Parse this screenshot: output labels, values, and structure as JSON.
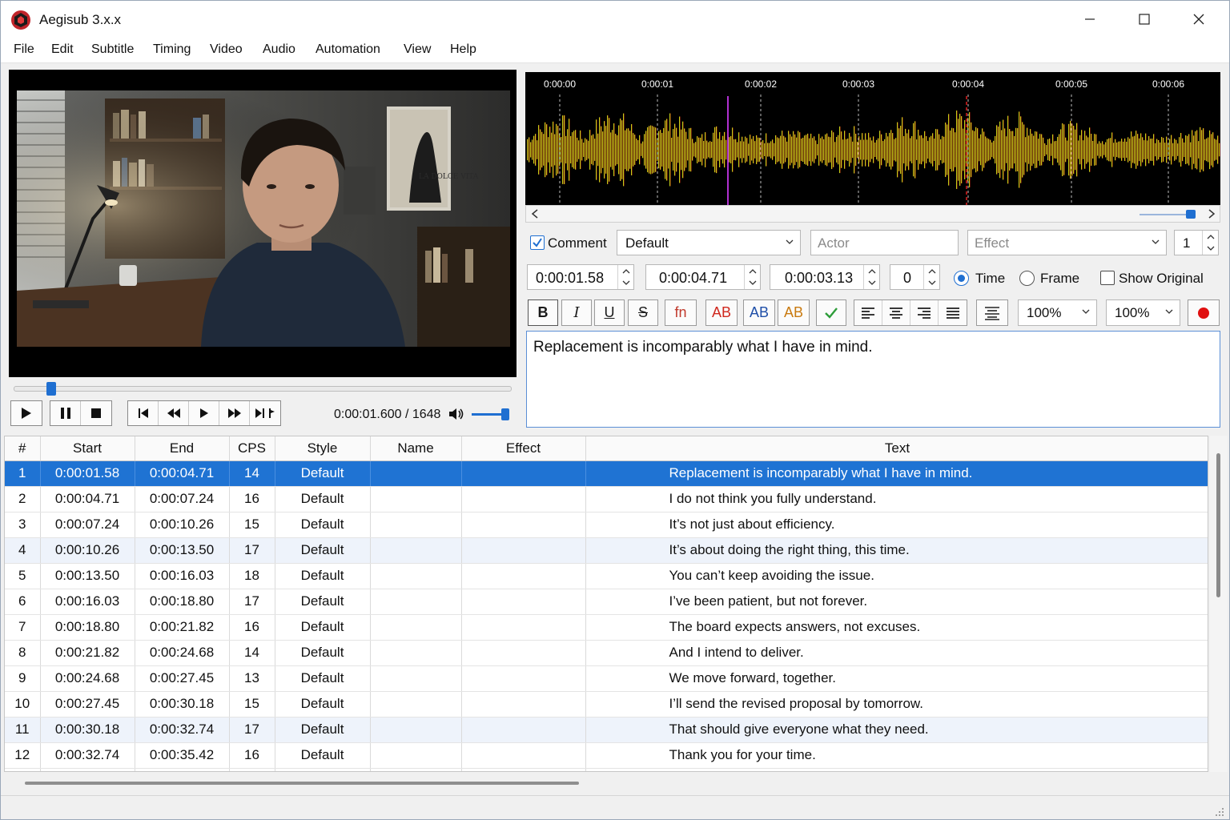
{
  "window": {
    "title": "Aegisub 3.x.x"
  },
  "menu": [
    "File",
    "Edit",
    "Subtitle",
    "Timing",
    "Video",
    "Audio",
    "Automation",
    "View",
    "Help"
  ],
  "video": {
    "time_readout": "0:00:01.600 / 1648",
    "poster_text": "LA DOLCE VITA"
  },
  "audio": {
    "time_marks": [
      "0:00:00",
      "0:00:01",
      "0:00:02",
      "0:00:03",
      "0:00:04",
      "0:00:05",
      "0:00:06"
    ]
  },
  "edit": {
    "comment_label": "Comment",
    "comment_checked": true,
    "style_value": "Default",
    "actor_placeholder": "Actor",
    "effect_placeholder": "Effect",
    "layer": "1",
    "start_time": "0:00:01.58",
    "end_time": "0:00:04.71",
    "duration": "0:00:03.13",
    "margin": "0",
    "mode_time_label": "Time",
    "mode_frame_label": "Frame",
    "mode_selected": "Time",
    "show_original_label": "Show Original",
    "format_buttons": {
      "bold": "B",
      "italic": "I",
      "underline": "U",
      "strike": "S",
      "font": "fn",
      "color1": "AB",
      "color2": "AB",
      "color3": "AB"
    },
    "scale_x": "100%",
    "scale_y": "100%",
    "text": "Replacement is incomparably what I have in mind."
  },
  "grid": {
    "columns": [
      "#",
      "Start",
      "End",
      "CPS",
      "Style",
      "Name",
      "Effect",
      "Text"
    ],
    "selected_row": 1,
    "rows": [
      [
        "1",
        "0:00:01.58",
        "0:00:04.71",
        "14",
        "Default",
        "",
        "",
        "Replacement is incomparably what I have in mind."
      ],
      [
        "2",
        "0:00:04.71",
        "0:00:07.24",
        "16",
        "Default",
        "",
        "",
        "I do not think you fully understand."
      ],
      [
        "3",
        "0:00:07.24",
        "0:00:10.26",
        "15",
        "Default",
        "",
        "",
        "It’s not just about efficiency."
      ],
      [
        "4",
        "0:00:10.26",
        "0:00:13.50",
        "17",
        "Default",
        "",
        "",
        "It’s about doing the right thing, this time."
      ],
      [
        "5",
        "0:00:13.50",
        "0:00:16.03",
        "18",
        "Default",
        "",
        "",
        "You can’t keep avoiding the issue."
      ],
      [
        "6",
        "0:00:16.03",
        "0:00:18.80",
        "17",
        "Default",
        "",
        "",
        "I’ve been patient, but not forever."
      ],
      [
        "7",
        "0:00:18.80",
        "0:00:21.82",
        "16",
        "Default",
        "",
        "",
        "The board expects answers, not excuses."
      ],
      [
        "8",
        "0:00:21.82",
        "0:00:24.68",
        "14",
        "Default",
        "",
        "",
        "And I intend to deliver."
      ],
      [
        "9",
        "0:00:24.68",
        "0:00:27.45",
        "13",
        "Default",
        "",
        "",
        "We move forward, together."
      ],
      [
        "10",
        "0:00:27.45",
        "0:00:30.18",
        "15",
        "Default",
        "",
        "",
        "I’ll send the revised proposal by tomorrow."
      ],
      [
        "11",
        "0:00:30.18",
        "0:00:32.74",
        "17",
        "Default",
        "",
        "",
        "That should give everyone what they need."
      ],
      [
        "12",
        "0:00:32.74",
        "0:00:35.42",
        "16",
        "Default",
        "",
        "",
        "Thank you for your time."
      ]
    ]
  },
  "colors": {
    "accent": "#1f73d3",
    "record": "#e01010",
    "check": "#2e9d3a"
  }
}
